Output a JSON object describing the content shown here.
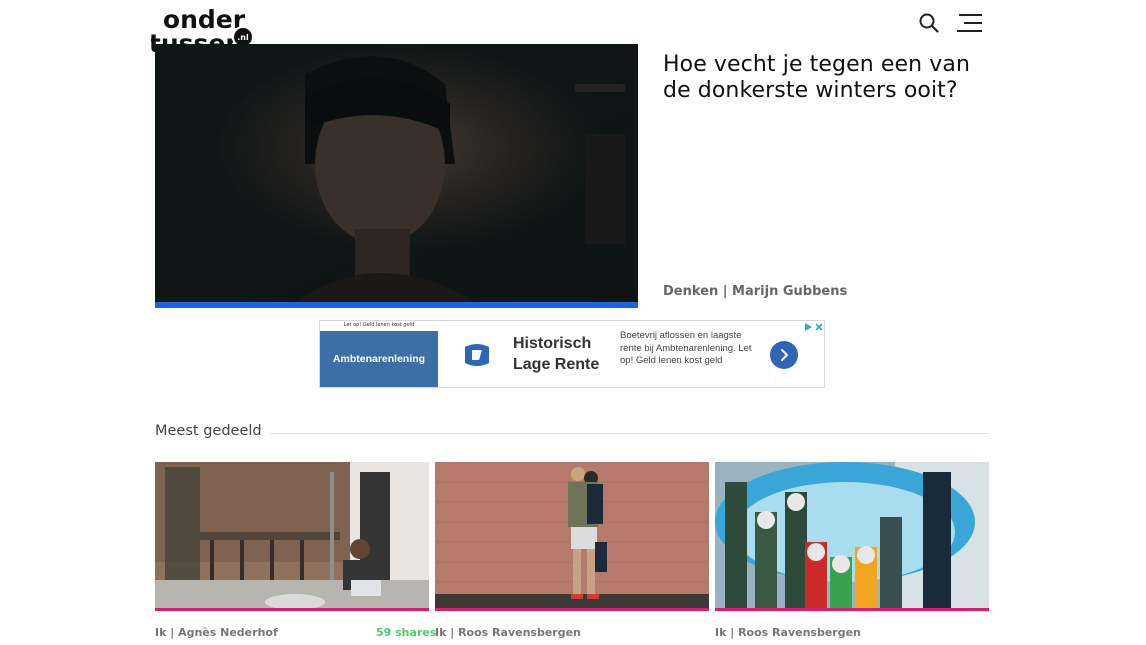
{
  "header": {
    "logo_line1": "onder",
    "logo_line2": "tussen",
    "logo_badge": ".nl",
    "icons": [
      "search-icon",
      "hamburger-menu-icon"
    ]
  },
  "hero": {
    "title": "Hoe vecht je tegen een van de donkerste winters ooit?",
    "meta": "Denken | Marijn Gubbens",
    "accent_color": "#1a64e0"
  },
  "ad": {
    "small_text": "Let op! Geld lenen kost geld",
    "brand": "Ambtenarenlening",
    "headline": "Historisch Lage Rente",
    "copy": "Boetevrij aflossen en laagste rente bij Ambtenarenlening. Let op! Geld lenen kost geld",
    "brand_color": "#3c6ea8",
    "icons": [
      "ad-logo-icon",
      "chevron-right-icon",
      "ad-choices-icon"
    ]
  },
  "most_shared": {
    "title": "Meest gedeeld",
    "accent_color": "#d6206e",
    "cards": [
      {
        "meta": "Ik | Agnès Nederhof",
        "shares": "59 shares"
      },
      {
        "meta": "Ik | Roos Ravensbergen",
        "shares": ""
      },
      {
        "meta": "Ik | Roos Ravensbergen",
        "shares": ""
      }
    ]
  }
}
